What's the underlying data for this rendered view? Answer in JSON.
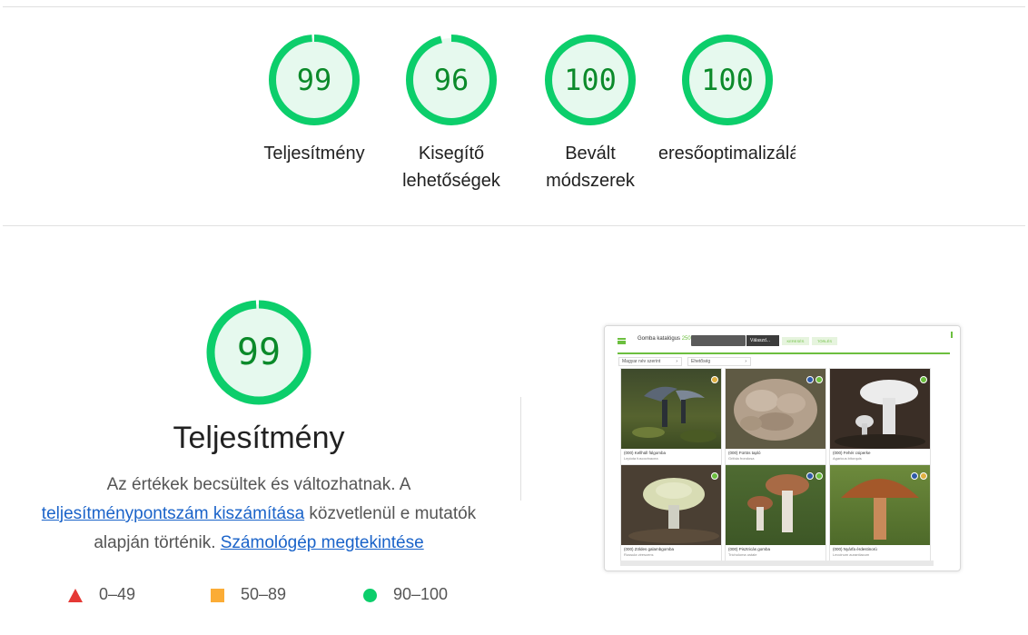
{
  "gauges": [
    {
      "score": "99",
      "label": "Teljesítmény"
    },
    {
      "score": "96",
      "label": "Kisegítő\nlehetőségek"
    },
    {
      "score": "100",
      "label": "Bevált\nmódszerek"
    },
    {
      "score": "100",
      "label": "Keresőoptimalizálás"
    }
  ],
  "performance": {
    "score": "99",
    "title": "Teljesítmény",
    "desc_1": "Az értékek becsültek és változhatnak. A",
    "calc_link": "teljesítménypontszám kiszámítása",
    "desc_2": " közvetlenül e mutatók alapján történik. ",
    "calculator_link": "Számológép megtekintése"
  },
  "legend": [
    {
      "range": "0–49",
      "symbol": "red-triangle"
    },
    {
      "range": "50–89",
      "symbol": "orange-square"
    },
    {
      "range": "90–100",
      "symbol": "green-circle"
    }
  ],
  "colors": {
    "pass_ring": "#0cce6b",
    "pass_fill": "#e6f9ee",
    "pass_text": "#0b8a2a",
    "link": "#1a63c9"
  },
  "thumbnail": {
    "brand": "Gomba katalógus",
    "brand_count": "250 db",
    "select_label": "Válaszd...",
    "btn_1": "KERESÉS",
    "btn_2": "TÖRLÉS",
    "filter_1": "Magyar név szerint",
    "filter_2": "Ehetőség",
    "cards": [
      {
        "title": "(000) Kellhüll fülgomba",
        "subtitle": "Lepiota fuscovinacea"
      },
      {
        "title": "(000) Fürtös tapló",
        "subtitle": "Grifola frondosa"
      },
      {
        "title": "(000) Fehér csiperke",
        "subtitle": "Agaricus bitorquis"
      },
      {
        "title": "(000) Zöldes galambgomba",
        "subtitle": "Russula virescens"
      },
      {
        "title": "(000) Pisztricás gomba",
        "subtitle": "Tricholoma ustale"
      },
      {
        "title": "(000) Nyárfa érdestinorú",
        "subtitle": "Leccinum aurantiacum"
      }
    ]
  }
}
